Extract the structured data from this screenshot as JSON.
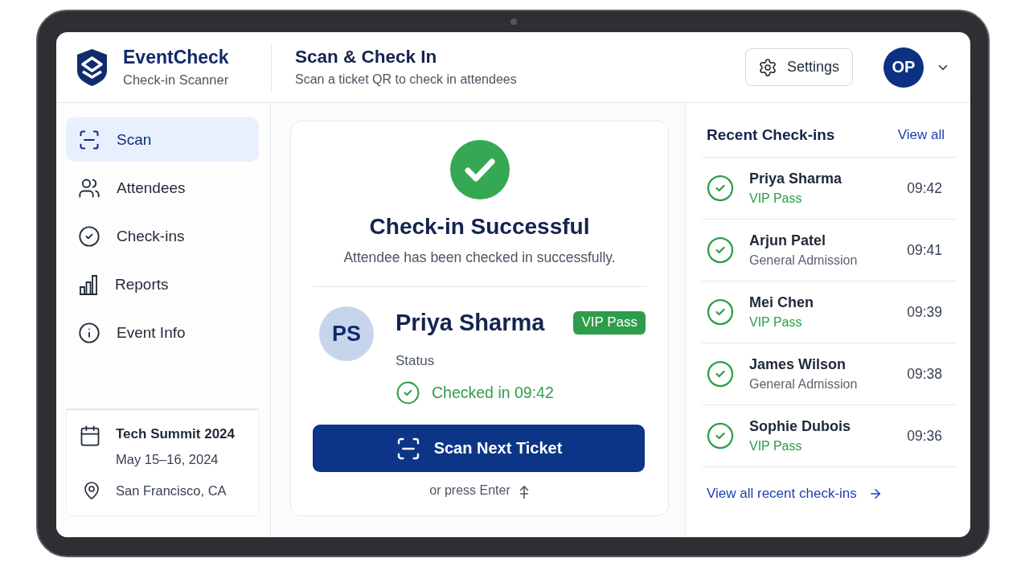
{
  "app": {
    "name": "EventCheck",
    "subtitle": "Check-in Scanner"
  },
  "header": {
    "title": "Scan & Check In",
    "subtitle": "Scan a ticket QR to check in attendees",
    "settings_button": "Settings",
    "user_initials": "OP"
  },
  "sidebar": {
    "items": [
      {
        "label": "Scan",
        "selected": true
      },
      {
        "label": "Attendees",
        "selected": false
      },
      {
        "label": "Check-ins",
        "selected": false
      },
      {
        "label": "Reports",
        "selected": false
      },
      {
        "label": "Event Info",
        "selected": false
      }
    ],
    "event": {
      "name": "Tech Summit 2024",
      "dates": "May 15–16, 2024",
      "location": "San Francisco, CA"
    }
  },
  "checkin": {
    "title": "Check-in Successful",
    "message": "Attendee has been checked in successfully.",
    "attendee": {
      "initials": "PS",
      "name": "Priya Sharma",
      "pass": "VIP Pass",
      "status_label": "Status",
      "status": "Checked in 09:42"
    },
    "button": "Scan Next Ticket",
    "hint": "or press Enter"
  },
  "recent": {
    "title": "Recent Check-ins",
    "view_all": "View all",
    "items": [
      {
        "name": "Priya Sharma",
        "pass": "VIP Pass",
        "kind": "vip",
        "time": "09:42"
      },
      {
        "name": "Arjun Patel",
        "pass": "General Admission",
        "kind": "general",
        "time": "09:41"
      },
      {
        "name": "Mei Chen",
        "pass": "VIP Pass",
        "kind": "vip",
        "time": "09:39"
      },
      {
        "name": "James Wilson",
        "pass": "General Admission",
        "kind": "general",
        "time": "09:38"
      },
      {
        "name": "Sophie Dubois",
        "pass": "VIP Pass",
        "kind": "vip",
        "time": "09:36"
      }
    ],
    "footer_link": "View all recent check-ins"
  }
}
